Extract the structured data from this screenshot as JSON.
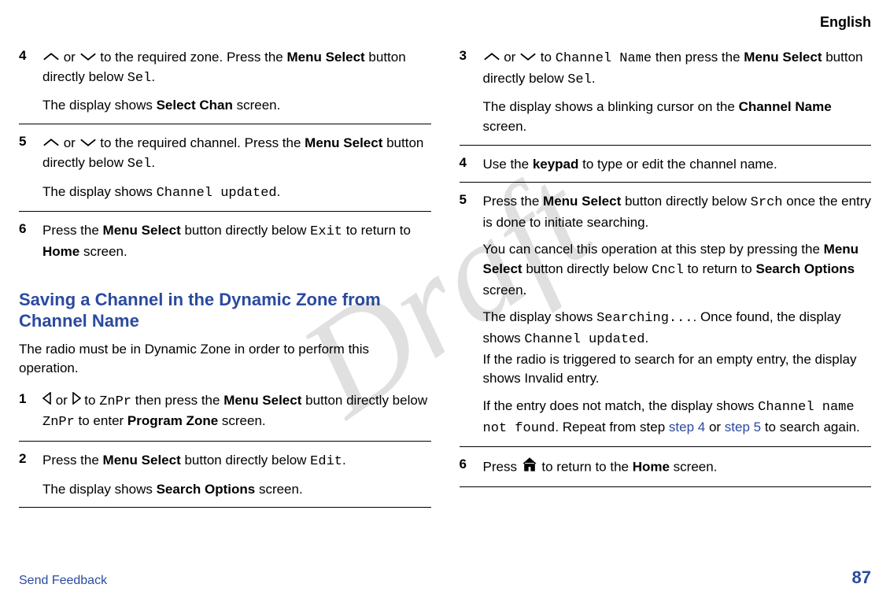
{
  "header": {
    "language": "English"
  },
  "watermark": "Draft",
  "footer": {
    "send_feedback": "Send Feedback",
    "page_number": "87"
  },
  "left": {
    "step4": {
      "num": "4",
      "t1a": " or ",
      "t1b": " to the required zone. Press the ",
      "menu_select": "Menu Select",
      "t1c": " button directly below ",
      "sel": "Sel",
      "t1d": ".",
      "t2a": "The display shows ",
      "select_chan": "Select Chan",
      "t2b": " screen."
    },
    "step5": {
      "num": "5",
      "t1a": " or ",
      "t1b": " to the required channel. Press the ",
      "menu_select": "Menu Select",
      "t1c": " button directly below ",
      "sel": "Sel",
      "t1d": ".",
      "t2a": "The display shows ",
      "channel_updated": "Channel updated",
      "t2b": "."
    },
    "step6": {
      "num": "6",
      "t1a": "Press the ",
      "menu_select": "Menu Select",
      "t1b": " button directly below ",
      "exit": "Exit",
      "t1c": " to return to ",
      "home": "Home",
      "t1d": " screen."
    },
    "section_title": "Saving a Channel in the Dynamic Zone from Channel Name",
    "section_intro": "The radio must be in Dynamic Zone in order to perform this operation.",
    "b_step1": {
      "num": "1",
      "t1a": " or ",
      "t1b": " to ",
      "znpr": "ZnPr",
      "t1c": " then press the ",
      "menu_select": "Menu Select",
      "t1d": " button directly below ",
      "znpr2": "ZnPr",
      "t1e": " to enter ",
      "program_zone": "Program Zone",
      "t1f": " screen."
    },
    "b_step2": {
      "num": "2",
      "t1a": "Press the ",
      "menu_select": "Menu Select",
      "t1b": " button directly below ",
      "edit": "Edit",
      "t1c": ".",
      "t2a": "The display shows ",
      "search_options": "Search Options",
      "t2b": " screen."
    }
  },
  "right": {
    "step3": {
      "num": "3",
      "t1a": " or ",
      "t1b": " to ",
      "channel_name": "Channel Name",
      "t1c": " then press the ",
      "menu_select": "Menu Select",
      "t1d": " button directly below ",
      "sel": "Sel",
      "t1e": ".",
      "t2a": "The display shows a blinking cursor on the ",
      "channel_name2": "Channel Name",
      "t2b": " screen."
    },
    "step4": {
      "num": "4",
      "t1a": "Use the ",
      "keypad": "keypad",
      "t1b": " to type or edit the channel name."
    },
    "step5": {
      "num": "5",
      "t1a": "Press the ",
      "menu_select": "Menu Select",
      "t1b": " button directly below ",
      "srch": "Srch",
      "t1c": " once the entry is done to initiate searching.",
      "t2a": "You can cancel this operation at this step by pressing the ",
      "menu_select2": "Menu Select",
      "t2b": " button directly below ",
      "cncl": "Cncl",
      "t2c": " to return to ",
      "search_options": "Search Options",
      "t2d": " screen.",
      "t3a": "The display shows ",
      "searching": "Searching...",
      "t3b": ". Once found, the display shows ",
      "channel_updated": "Channel updated",
      "t3c": ".",
      "t3d": "If the radio is triggered to search for an empty entry, the display shows Invalid entry.",
      "t4a": "If the entry does not match, the display shows ",
      "not_found": "Channel name not found",
      "t4b": ". Repeat from step ",
      "link_step4": "step 4",
      "t4c": " or ",
      "link_step5": "step 5",
      "t4d": " to search again."
    },
    "step6": {
      "num": "6",
      "t1a": "Press ",
      "t1b": " to return to the ",
      "home": "Home",
      "t1c": " screen."
    }
  }
}
